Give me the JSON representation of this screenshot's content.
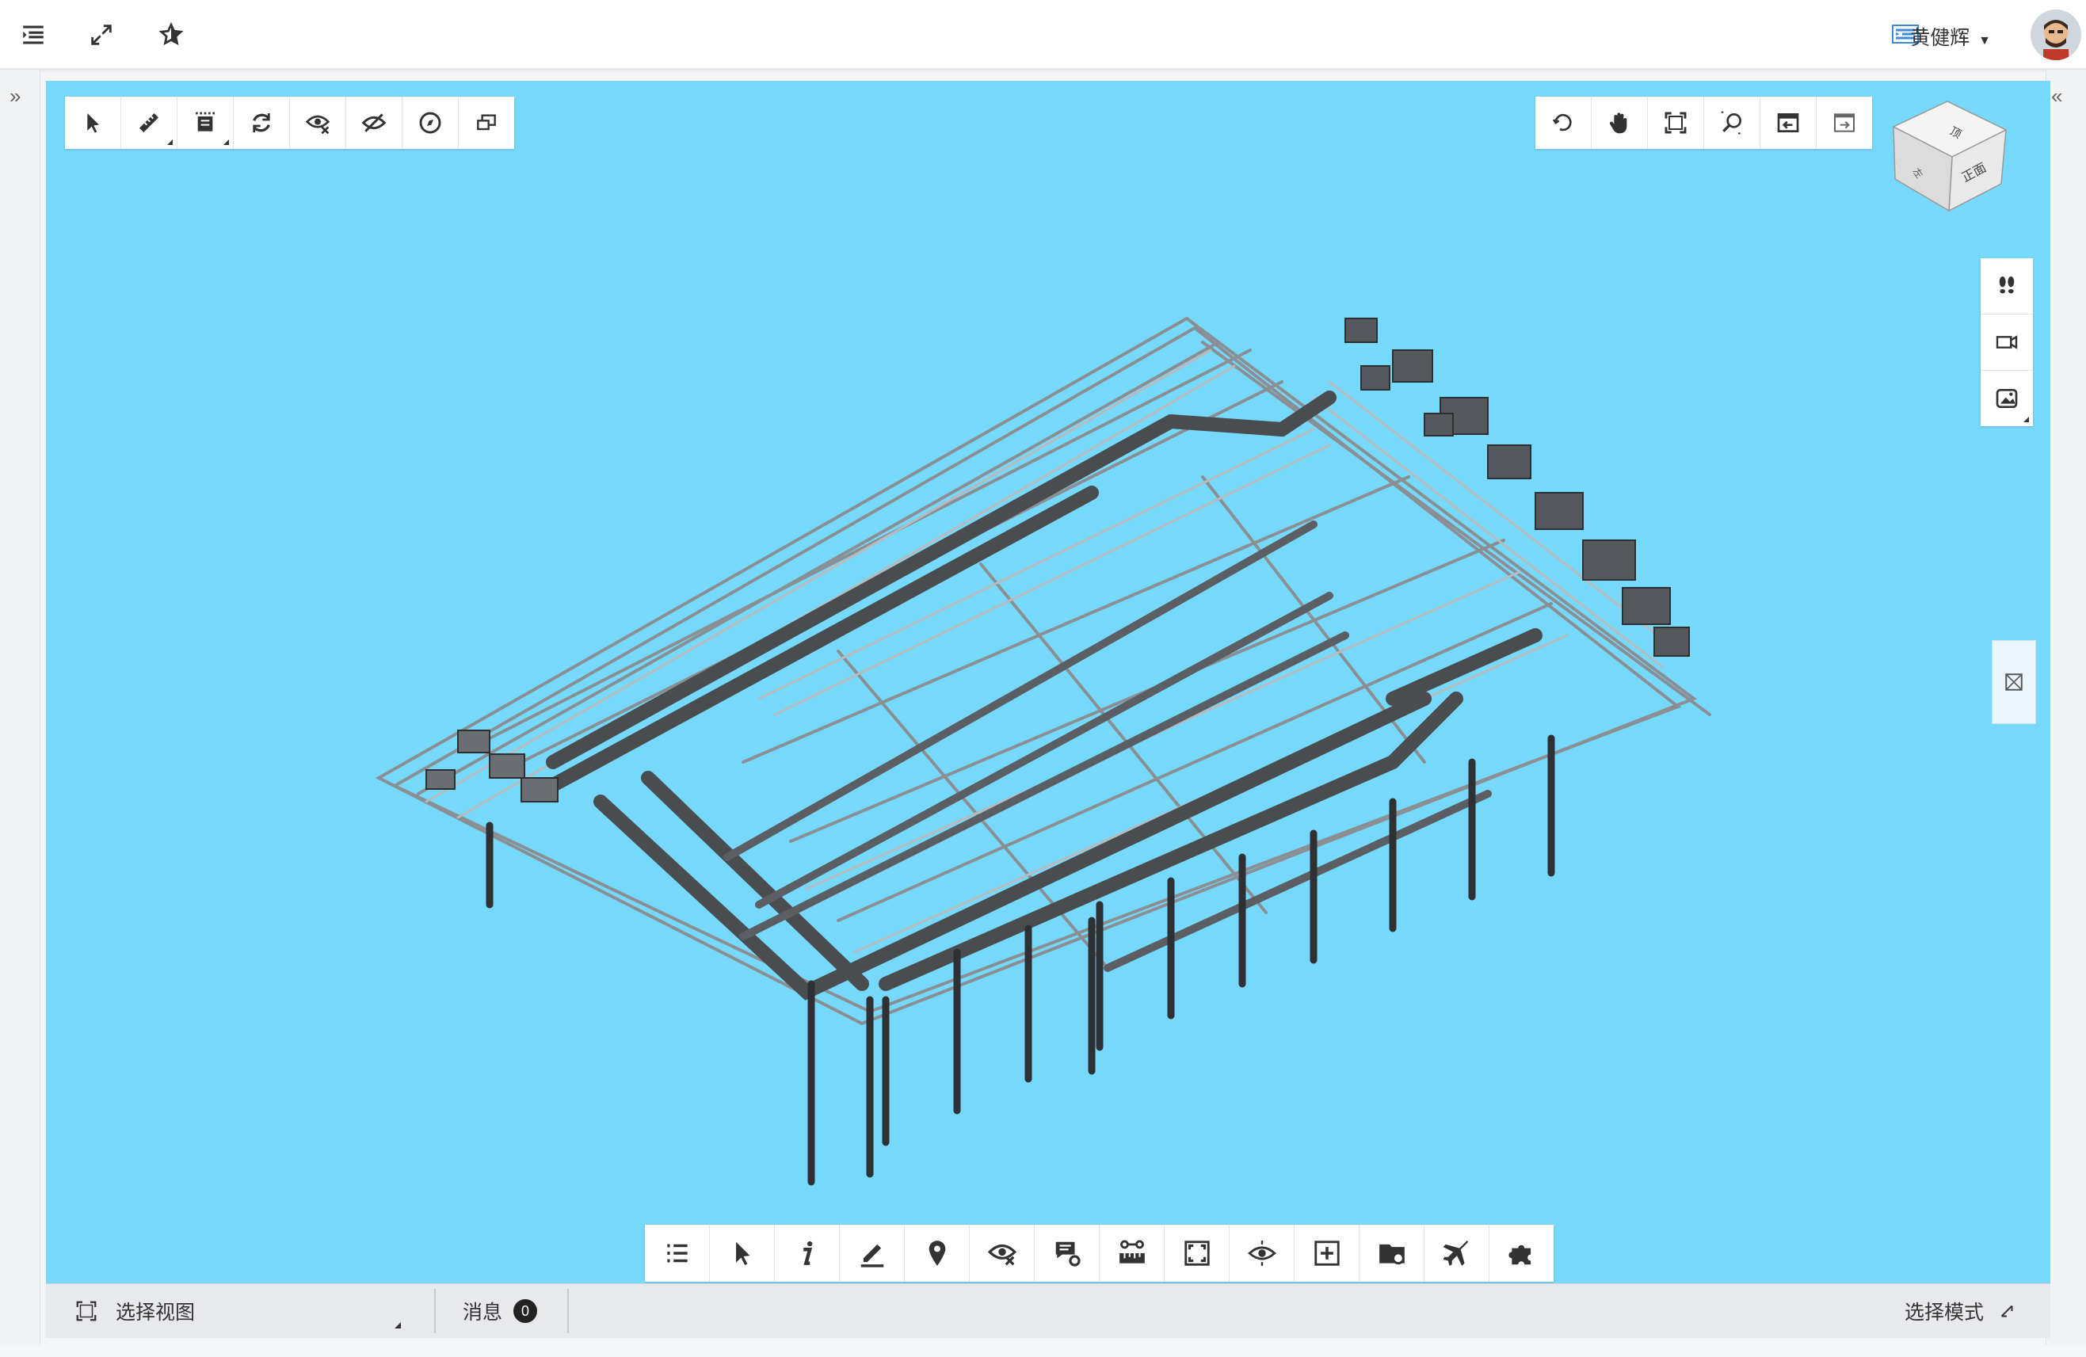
{
  "header": {
    "icons": [
      "menu-toggle-icon",
      "fullscreen-icon",
      "favorite-star-icon"
    ],
    "user": {
      "name": "黄健辉"
    }
  },
  "viewport": {
    "background_color": "#76d9fb",
    "top_left_tools": [
      "select-arrow-icon",
      "measure-ruler-icon",
      "section-box-icon",
      "rotate-icon",
      "hide-icon",
      "isolate-icon",
      "compass-icon",
      "window-icon"
    ],
    "top_right_tools": [
      "orbit-icon",
      "pan-hand-icon",
      "fit-view-icon",
      "zoom-window-icon",
      "view-left-icon",
      "view-right-icon"
    ],
    "view_cube": {
      "top": "顶",
      "front": "正面",
      "left": "左"
    },
    "right_panel_tools": [
      "walk-footprints-icon",
      "camera-icon",
      "screenshot-icon"
    ],
    "bottom_tools": [
      "list-icon",
      "select-arrow-icon",
      "info-icon",
      "markup-pen-icon",
      "location-pin-icon",
      "hide-icon",
      "settings-chat-icon",
      "ruler-measure-icon",
      "fit-view-icon",
      "view-eye-icon",
      "add-section-icon",
      "folder-settings-icon",
      "airplane-icon",
      "puzzle-icon"
    ]
  },
  "statusbar": {
    "view_label": "选择视图",
    "message_label": "消息",
    "message_count": "0",
    "mode_label": "选择模式"
  }
}
